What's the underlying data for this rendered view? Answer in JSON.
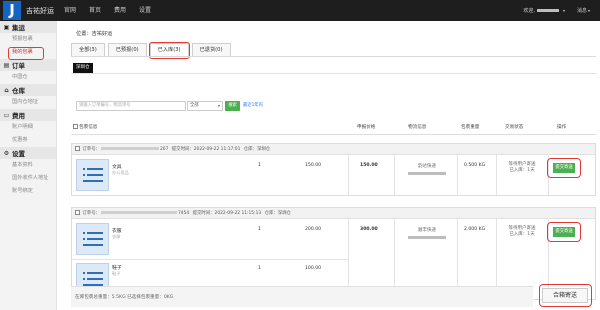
{
  "app": {
    "brand": "吉祐好运",
    "logo_letter": "J",
    "nav": [
      "官网",
      "首页",
      "费用",
      "设置"
    ],
    "welcome": "欢迎,",
    "user_caret": "▾",
    "messages": "消息",
    "messages_caret": "▾"
  },
  "sidebar": {
    "sections": [
      {
        "title": "集运",
        "icon": "box-icon",
        "items": [
          "预报包裹",
          "我的包裹"
        ]
      },
      {
        "title": "订单",
        "icon": "list-icon",
        "items": [
          "中国仓"
        ]
      },
      {
        "title": "仓库",
        "icon": "warehouse-icon",
        "items": [
          "国内仓地址"
        ]
      },
      {
        "title": "费用",
        "icon": "card-icon",
        "items": [
          "账户明细",
          "优惠券"
        ]
      },
      {
        "title": "设置",
        "icon": "gear-icon",
        "items": [
          "基本资料",
          "国外收件人地址",
          "账号绑定"
        ]
      }
    ],
    "active_item": "我的包裹"
  },
  "main": {
    "location": "位置：吉祐好运",
    "tabs": [
      "全部(3)",
      "已预报(0)",
      "已入库(3)",
      "已退货(0)"
    ],
    "active_tab": "已入库(3)",
    "warehouse_tab": "深圳仓",
    "search": {
      "placeholder": "请输入订单编号、物流单号",
      "select_value": "全部",
      "select_caret": "▾",
      "button": "搜索",
      "recent": "最近1年内"
    },
    "table_headers": [
      "包裹信息",
      "申报价格",
      "物流信息",
      "包裹重量",
      "交易状态",
      "操作"
    ],
    "orders": [
      {
        "order_label": "订单号：",
        "order_suffix": "267",
        "submit_time": "提交时间：2022-09-22 11:17:01",
        "warehouse": "仓库：深圳仓",
        "items": [
          {
            "name": "文具",
            "sub": "办公用品",
            "qty": "1",
            "price": "150.00"
          }
        ],
        "declared": "150.00",
        "logistics": "韵达快递",
        "weight": "0.500 KG",
        "status_lines": [
          "等待用户寄送",
          "已入库：1天"
        ],
        "action": "提交寄送"
      },
      {
        "order_label": "订单号：",
        "order_suffix": "7454",
        "submit_time": "提交时间：2022-09-22 11:15:13",
        "warehouse": "仓库：深圳仓",
        "items": [
          {
            "name": "衣服",
            "sub": "衣服",
            "qty": "1",
            "price": "200.00"
          },
          {
            "name": "鞋子",
            "sub": "鞋子",
            "qty": "1",
            "price": "100.00"
          }
        ],
        "declared": "300.00",
        "logistics": "顺丰快递",
        "weight": "2.000 KG",
        "status_lines": [
          "等待用户寄送",
          "已入库：1天"
        ],
        "action": "提交寄送"
      }
    ],
    "footer": "在库包裹总重量：5.5KG  已选择包裹重量：0KG",
    "merge_button": "合箱寄送"
  }
}
